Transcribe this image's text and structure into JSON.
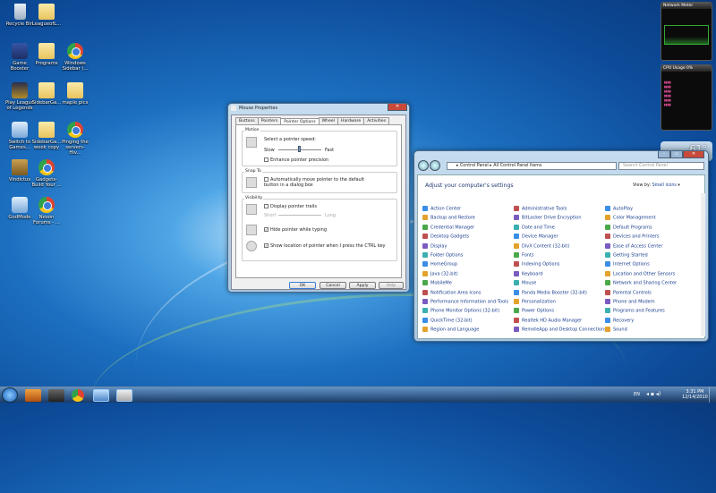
{
  "desktop": {
    "icons": [
      {
        "label": "Recycle Bin"
      },
      {
        "label": "LeagueofL..."
      },
      {
        "label": "Game Booster"
      },
      {
        "label": "Programs"
      },
      {
        "label": "Windows Sidebar (..."
      },
      {
        "label": "Play League of Legends"
      },
      {
        "label": "SidebarGa..."
      },
      {
        "label": "maple pics"
      },
      {
        "label": "Switch to Games..."
      },
      {
        "label": "SidebarGa... week copy"
      },
      {
        "label": "Pinging the servers- Hiv..."
      },
      {
        "label": "Vindictus"
      },
      {
        "label": "Gadgets- Build Your ..."
      },
      {
        "label": "GodMode"
      },
      {
        "label": "Nexon Forums - ..."
      }
    ]
  },
  "gadgets": {
    "network_meter": "Network Meter",
    "cpu": {
      "title": "CPU Usage",
      "pct": "0%"
    },
    "weather_temp": "61°"
  },
  "mouse_dialog": {
    "title": "Mouse Properties",
    "tabs": [
      "Buttons",
      "Pointers",
      "Pointer Options",
      "Wheel",
      "Hardware",
      "Activities"
    ],
    "motion": {
      "group": "Motion",
      "label": "Select a pointer speed:",
      "slow": "Slow",
      "fast": "Fast",
      "precision": "Enhance pointer precision",
      "speed_pct": 0.5
    },
    "snap": {
      "group": "Snap To",
      "option": "Automatically move pointer to the default button in a dialog box"
    },
    "visibility": {
      "group": "Visibility",
      "trails": "Display pointer trails",
      "short": "Short",
      "long": "Long",
      "hide": "Hide pointer while typing",
      "show_ctrl": "Show location of pointer when I press the CTRL key"
    },
    "buttons": {
      "ok": "OK",
      "cancel": "Cancel",
      "apply": "Apply",
      "help": "Help"
    }
  },
  "control_panel": {
    "breadcrumb": [
      "Control Panel",
      "All Control Panel Items"
    ],
    "search_placeholder": "Search Control Panel",
    "heading": "Adjust your computer's settings",
    "view_by": "View by:",
    "view_value": "Small icons",
    "columns": [
      [
        "Action Center",
        "Backup and Restore",
        "Credential Manager",
        "Desktop Gadgets",
        "Display",
        "Folder Options",
        "HomeGroup",
        "Java (32-bit)",
        "MobileMe",
        "Notification Area Icons",
        "Performance Information and Tools",
        "Phone Monitor Options (32-bit)",
        "QuickTime (32-bit)",
        "Region and Language"
      ],
      [
        "Administrative Tools",
        "BitLocker Drive Encryption",
        "Date and Time",
        "Device Manager",
        "DivX Content (32-bit)",
        "Fonts",
        "Indexing Options",
        "Keyboard",
        "Mouse",
        "Panda Media Booster (32-bit)",
        "Personalization",
        "Power Options",
        "Realtek HD Audio Manager",
        "RemoteApp and Desktop Connections"
      ],
      [
        "AutoPlay",
        "Color Management",
        "Default Programs",
        "Devices and Printers",
        "Ease of Access Center",
        "Getting Started",
        "Internet Options",
        "Location and Other Sensors",
        "Network and Sharing Center",
        "Parental Controls",
        "Phone and Modem",
        "Programs and Features",
        "Recovery",
        "Sound"
      ]
    ]
  },
  "taskbar": {
    "lang": "EN",
    "time": "3:31 PM",
    "date": "12/14/2010"
  }
}
